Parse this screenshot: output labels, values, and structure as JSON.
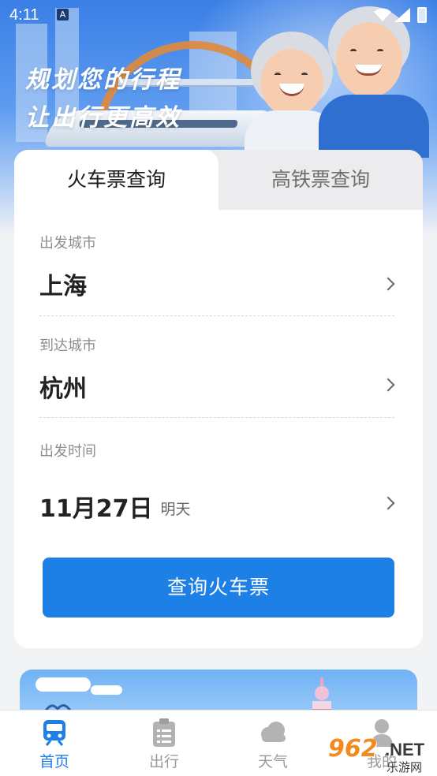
{
  "status_bar": {
    "time": "4:11",
    "notification_icon": "A"
  },
  "hero": {
    "line1": "规划您的行程",
    "line2": "让出行更高效"
  },
  "tabs": [
    {
      "label": "火车票查询",
      "active": true
    },
    {
      "label": "高铁票查询",
      "active": false
    }
  ],
  "form": {
    "departure": {
      "label": "出发城市",
      "value": "上海"
    },
    "arrival": {
      "label": "到达城市",
      "value": "杭州"
    },
    "date": {
      "label": "出发时间",
      "value": "11月27日",
      "sub": "明天"
    }
  },
  "query_button": "查询火车票",
  "bottom_nav": [
    {
      "label": "首页",
      "icon": "train-icon",
      "active": true
    },
    {
      "label": "出行",
      "icon": "clipboard-icon",
      "active": false
    },
    {
      "label": "天气",
      "icon": "cloud-icon",
      "active": false
    },
    {
      "label": "我的",
      "icon": "person-icon",
      "active": false
    }
  ],
  "watermark": {
    "number": "962",
    "suffix": ".NET",
    "text": "乐游网"
  },
  "colors": {
    "accent": "#1d80e6",
    "tab_inactive_bg": "#ececee",
    "page_bg": "#f2f3f5"
  }
}
